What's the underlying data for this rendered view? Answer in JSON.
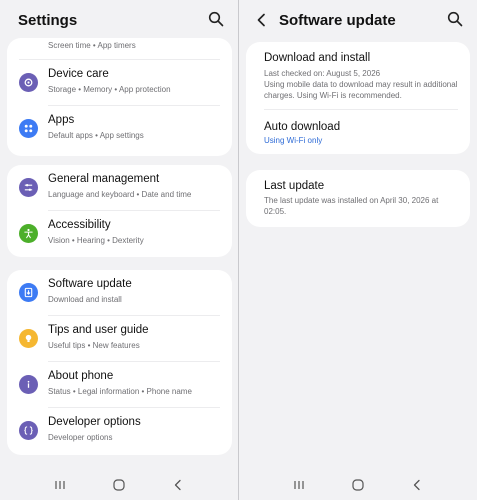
{
  "left": {
    "header": {
      "title": "Settings"
    },
    "partial_item": {
      "subtitle": "Screen time • App timers"
    },
    "group1": [
      {
        "title": "Device care",
        "subtitle": "Storage • Memory • App protection",
        "icon": "device-care-icon",
        "color": "#6b5fb5"
      },
      {
        "title": "Apps",
        "subtitle": "Default apps • App settings",
        "icon": "apps-icon",
        "color": "#3d7bf4"
      }
    ],
    "group2": [
      {
        "title": "General management",
        "subtitle": "Language and keyboard • Date and time",
        "icon": "general-management-icon",
        "color": "#6b5fb5"
      },
      {
        "title": "Accessibility",
        "subtitle": "Vision • Hearing • Dexterity",
        "icon": "accessibility-icon",
        "color": "#4caf2a"
      }
    ],
    "group3": [
      {
        "title": "Software update",
        "subtitle": "Download and install",
        "icon": "software-update-icon",
        "color": "#3d7bf4"
      },
      {
        "title": "Tips and user guide",
        "subtitle": "Useful tips • New features",
        "icon": "tips-icon",
        "color": "#f5b731"
      },
      {
        "title": "About phone",
        "subtitle": "Status • Legal information • Phone name",
        "icon": "info-icon",
        "color": "#6b5fb5"
      },
      {
        "title": "Developer options",
        "subtitle": "Developer options",
        "icon": "developer-options-icon",
        "color": "#6b5fb5"
      }
    ]
  },
  "right": {
    "header": {
      "title": "Software update"
    },
    "download": {
      "title": "Download and install",
      "checked": "Last checked on: August 5, 2026",
      "note": "Using mobile data to download may result in additional charges. Using Wi-Fi is recommended."
    },
    "auto": {
      "title": "Auto download",
      "value": "Using Wi-Fi only"
    },
    "last": {
      "title": "Last update",
      "text": "The last update was installed on April 30, 2026 at 02:05."
    }
  },
  "colors": {
    "accent_link": "#2e6bd6",
    "background": "#f2f2f4"
  }
}
